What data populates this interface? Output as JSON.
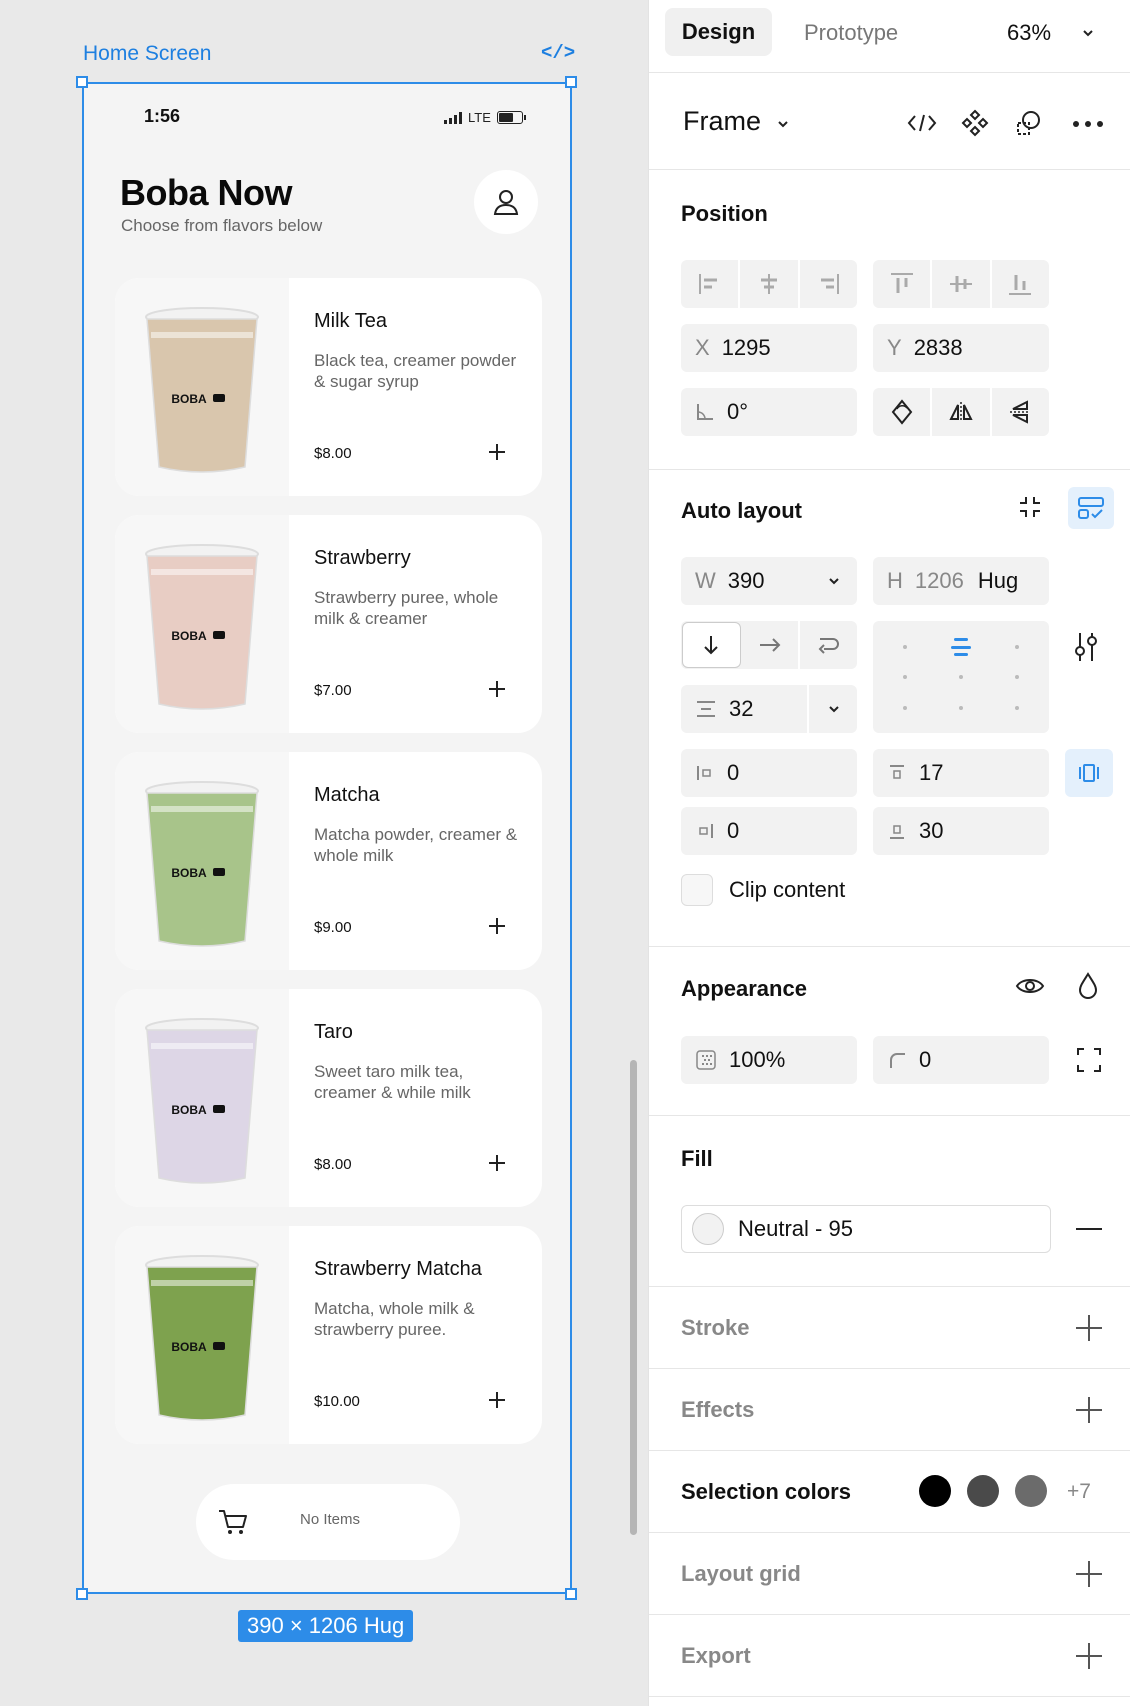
{
  "canvas": {
    "frame_label": "Home Screen",
    "code_tag": "</>",
    "size_badge": "390 × 1206 Hug"
  },
  "phone": {
    "status_time": "1:56",
    "status_network": "LTE",
    "title": "Boba Now",
    "subtitle": "Choose from flavors below",
    "products": [
      {
        "name": "Milk Tea",
        "description": "Black tea, creamer powder & sugar syrup",
        "price": "$8.00",
        "cup_label": "BOBA",
        "cup_color": "#d9c6ad"
      },
      {
        "name": "Strawberry",
        "description": "Strawberry puree, whole milk & creamer",
        "price": "$7.00",
        "cup_label": "BOBA",
        "cup_color": "#e8cdc4"
      },
      {
        "name": "Matcha",
        "description": "Matcha powder, creamer & whole milk",
        "price": "$9.00",
        "cup_label": "BOBA",
        "cup_color": "#a8c48a"
      },
      {
        "name": "Taro",
        "description": "Sweet taro milk tea, creamer & while milk",
        "price": "$8.00",
        "cup_label": "BOBA",
        "cup_color": "#ddd6e6"
      },
      {
        "name": "Strawberry Matcha",
        "description": "Matcha, whole milk & strawberry puree.",
        "price": "$10.00",
        "cup_label": "BOBA",
        "cup_color": "#7ea24e"
      }
    ],
    "cart_text": "No Items"
  },
  "panel": {
    "tabs": {
      "design": "Design",
      "prototype": "Prototype"
    },
    "zoom": "63%",
    "frame_title": "Frame",
    "position": {
      "title": "Position",
      "x_label": "X",
      "x_value": "1295",
      "y_label": "Y",
      "y_value": "2838",
      "rotation": "0°"
    },
    "auto_layout": {
      "title": "Auto layout",
      "w_label": "W",
      "w_value": "390",
      "h_label": "H",
      "h_value": "1206",
      "h_mode": "Hug",
      "gap": "32",
      "pad_left": "0",
      "pad_top": "17",
      "pad_right": "0",
      "pad_bottom": "30",
      "clip_label": "Clip content"
    },
    "appearance": {
      "title": "Appearance",
      "opacity": "100%",
      "radius": "0"
    },
    "fill": {
      "title": "Fill",
      "style_name": "Neutral - 95",
      "swatch_color": "#f2f2f2"
    },
    "stroke": {
      "title": "Stroke"
    },
    "effects": {
      "title": "Effects"
    },
    "selection_colors": {
      "title": "Selection colors",
      "colors": [
        "#000000",
        "#4a4a4a",
        "#6b6b6b"
      ],
      "more": "+7"
    },
    "layout_grid": {
      "title": "Layout grid"
    },
    "export": {
      "title": "Export"
    }
  },
  "colors": {
    "accent": "#2d8ce8",
    "panel_bg": "#ffffff",
    "canvas_bg": "#e9e9e9"
  }
}
